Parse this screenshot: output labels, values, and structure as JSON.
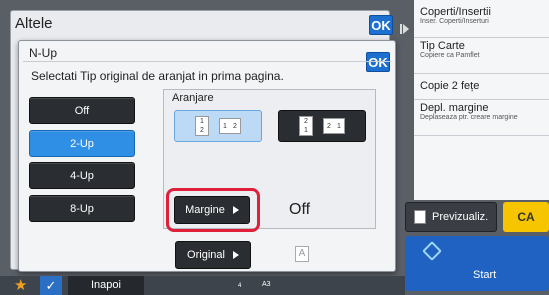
{
  "outer": {
    "title": "Altele",
    "ok": "OK"
  },
  "dialog": {
    "title": "N-Up",
    "ok": "OK",
    "instruction": "Selectati Tip original de aranjat in prima pagina.",
    "modes": [
      {
        "label": "Off",
        "selected": false
      },
      {
        "label": "2-Up",
        "selected": true
      },
      {
        "label": "4-Up",
        "selected": false
      },
      {
        "label": "8-Up",
        "selected": false
      }
    ],
    "aranjare": {
      "title": "Aranjare",
      "options": [
        {
          "icon": "layout-1-2-vertical-icon",
          "digits": [
            "1",
            "2"
          ],
          "selected": true
        },
        {
          "icon": "layout-2-1-vertical-icon",
          "digits": [
            "2",
            "1"
          ],
          "selected": false
        }
      ]
    },
    "margine": {
      "label": "Margine",
      "value": "Off"
    },
    "original": {
      "label": "Original",
      "letter": "A"
    }
  },
  "right_list": [
    {
      "main": "Coperti/Insertii",
      "sub": "Inser. Coperti/Inserturi"
    },
    {
      "main": "Tip Carte",
      "sub": "Copiere ca Pamflet"
    },
    {
      "main": "Copie 2 fețe",
      "sub": ""
    },
    {
      "main": "Depl. margine",
      "sub": "Deplaseaza ptr. creare margine"
    }
  ],
  "actions": {
    "preview": "Previzualiz.",
    "ca": "CA",
    "start": "Start"
  },
  "bottom": {
    "back": "Inapoi",
    "paper": "A3",
    "count": "4"
  },
  "colors": {
    "accent": "#2f8fe5",
    "highlight": "#e0203a",
    "ca": "#f6c500",
    "start": "#1f62c2"
  }
}
